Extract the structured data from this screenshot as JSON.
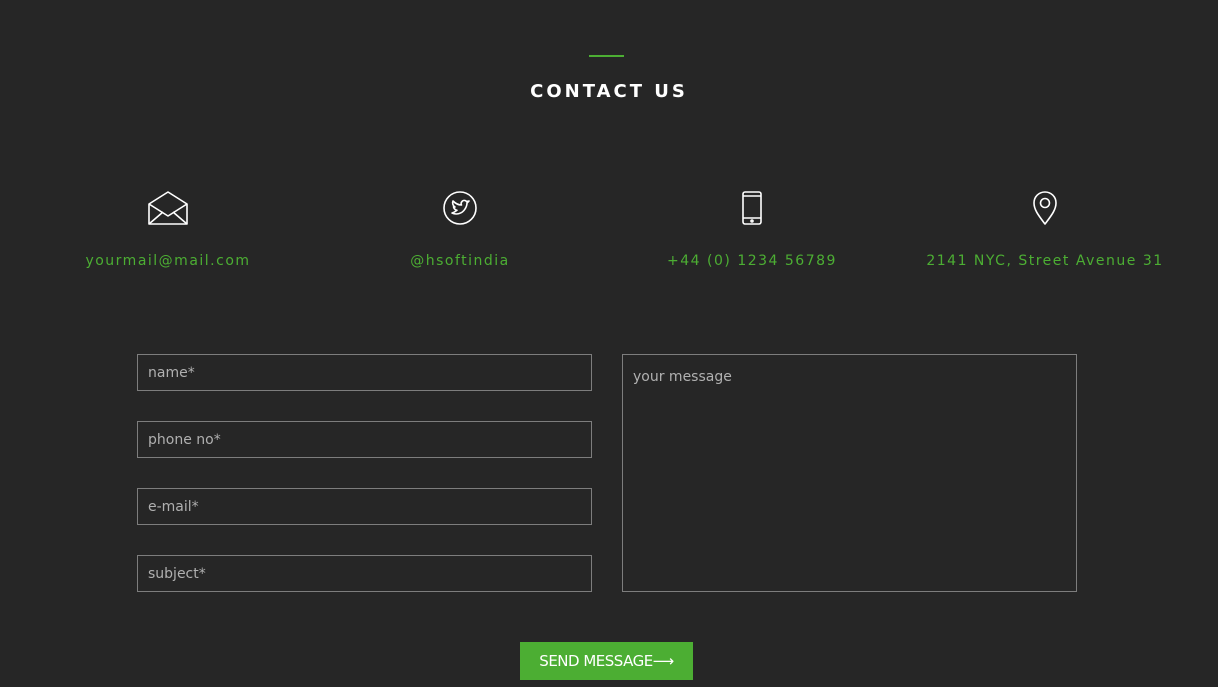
{
  "section": {
    "title": "CONTACT US",
    "accent_color": "#4cae33"
  },
  "contacts": [
    {
      "icon": "envelope-open-icon",
      "text": "yourmail@mail.com"
    },
    {
      "icon": "twitter-icon",
      "text": "@hsoftindia"
    },
    {
      "icon": "smartphone-icon",
      "text": "+44 (0) 1234 56789"
    },
    {
      "icon": "map-pin-icon",
      "text": "2141 NYC, Street Avenue 31"
    }
  ],
  "form": {
    "name_placeholder": "name*",
    "phone_placeholder": "phone no*",
    "email_placeholder": "e-mail*",
    "subject_placeholder": "subject*",
    "message_placeholder": "your message",
    "send_label": "SEND MESSAGE⟶"
  }
}
